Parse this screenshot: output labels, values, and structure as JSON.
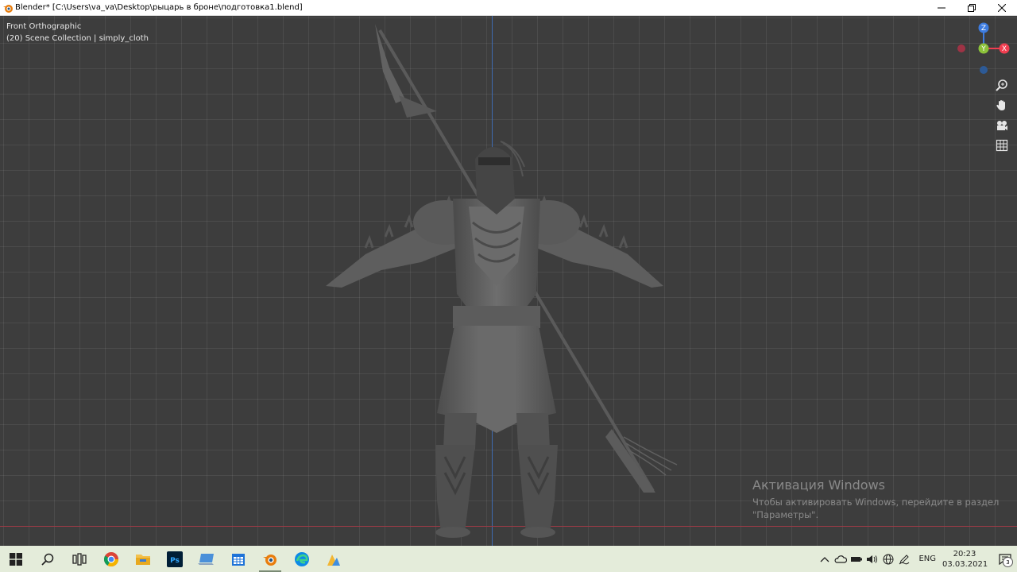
{
  "window": {
    "title": "Blender* [C:\\Users\\va_va\\Desktop\\рыцарь в броне\\подготовка1.blend]",
    "icon": "blender-icon",
    "controls": [
      "minimize-icon",
      "maximize-icon",
      "close-icon"
    ]
  },
  "viewport": {
    "view_name": "Front Orthographic",
    "collection_info": "(20) Scene Collection | simply_cloth",
    "model": "armored-knight-with-spear",
    "colors": {
      "background": "#3d3d3d",
      "z_axis": "#3f6bb0",
      "x_axis": "#9e3a46"
    }
  },
  "gizmo": {
    "axis_z": "Z",
    "axis_y": "Y",
    "axis_x": "X",
    "colors": {
      "z": "#3d7ce0",
      "y": "#8cc23a",
      "x": "#f03e50"
    }
  },
  "nav_tools": [
    "zoom-icon",
    "hand-pan-icon",
    "camera-icon",
    "grid-perspective-icon"
  ],
  "activation": {
    "title": "Активация Windows",
    "line1": "Чтобы активировать Windows, перейдите в раздел",
    "line2": "\"Параметры\"."
  },
  "taskbar": {
    "items": [
      "windows-start-icon",
      "search-icon",
      "task-view-icon",
      "chrome-icon",
      "file-explorer-icon",
      "photoshop-icon",
      "laptop-icon",
      "calendar-icon",
      "blender-icon",
      "edge-icon",
      "sketch-icon"
    ],
    "photoshop_label": "Ps",
    "language": "ENG",
    "time": "20:23",
    "date": "03.03.2021",
    "notification_count": "3"
  }
}
